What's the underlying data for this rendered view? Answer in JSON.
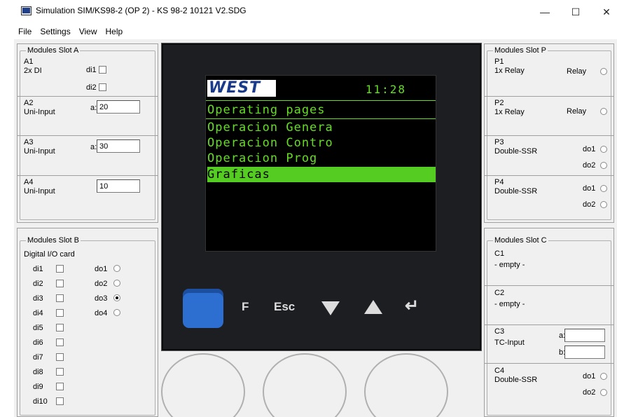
{
  "window": {
    "title": "Simulation SIM/KS98-2 (OP 2) - KS 98-2 10121 V2.SDG",
    "minimize": "—",
    "maximize": "☐",
    "close": "✕"
  },
  "menu": [
    "File",
    "Settings",
    "View",
    "Help"
  ],
  "slot_a": {
    "title": "Modules Slot A",
    "a1": {
      "id": "A1",
      "type": "2x DI",
      "di1": "di1",
      "di2": "di2"
    },
    "a2": {
      "id": "A2",
      "type": "Uni-Input",
      "label": "a:",
      "value": "20"
    },
    "a3": {
      "id": "A3",
      "type": "Uni-Input",
      "label": "a:",
      "value": "30"
    },
    "a4": {
      "id": "A4",
      "type": "Uni-Input",
      "value": "10"
    }
  },
  "slot_b": {
    "title": "Modules Slot B",
    "card": "Digital I/O card",
    "di": [
      "di1",
      "di2",
      "di3",
      "di4",
      "di5",
      "di6",
      "di7",
      "di8",
      "di9",
      "di10"
    ],
    "do": [
      "do1",
      "do2",
      "do3",
      "do4"
    ],
    "do_selected": 2
  },
  "slot_p": {
    "title": "Modules Slot P",
    "p1": {
      "id": "P1",
      "type": "1x Relay",
      "out": "Relay"
    },
    "p2": {
      "id": "P2",
      "type": "1x Relay",
      "out": "Relay"
    },
    "p3": {
      "id": "P3",
      "type": "Double-SSR",
      "do1": "do1",
      "do2": "do2"
    },
    "p4": {
      "id": "P4",
      "type": "Double-SSR",
      "do1": "do1",
      "do2": "do2"
    }
  },
  "slot_c": {
    "title": "Modules Slot C",
    "c1": {
      "id": "C1",
      "type": "- empty -"
    },
    "c2": {
      "id": "C2",
      "type": "- empty -"
    },
    "c3": {
      "id": "C3",
      "type": "TC-Input",
      "a": "a:",
      "b": "b:",
      "a_value": "",
      "b_value": ""
    },
    "c4": {
      "id": "C4",
      "type": "Double-SSR",
      "do1": "do1",
      "do2": "do2"
    }
  },
  "device": {
    "logo": "WEST",
    "time": "11:28",
    "heading": "Operating pages",
    "items": [
      "Operacion Genera",
      "Operacion Contro",
      "Operacion Prog",
      "Graficas"
    ],
    "selected_index": 3,
    "keys": {
      "f": "F",
      "esc": "Esc",
      "down": "▼",
      "up": "▲",
      "enter": "↵"
    }
  }
}
